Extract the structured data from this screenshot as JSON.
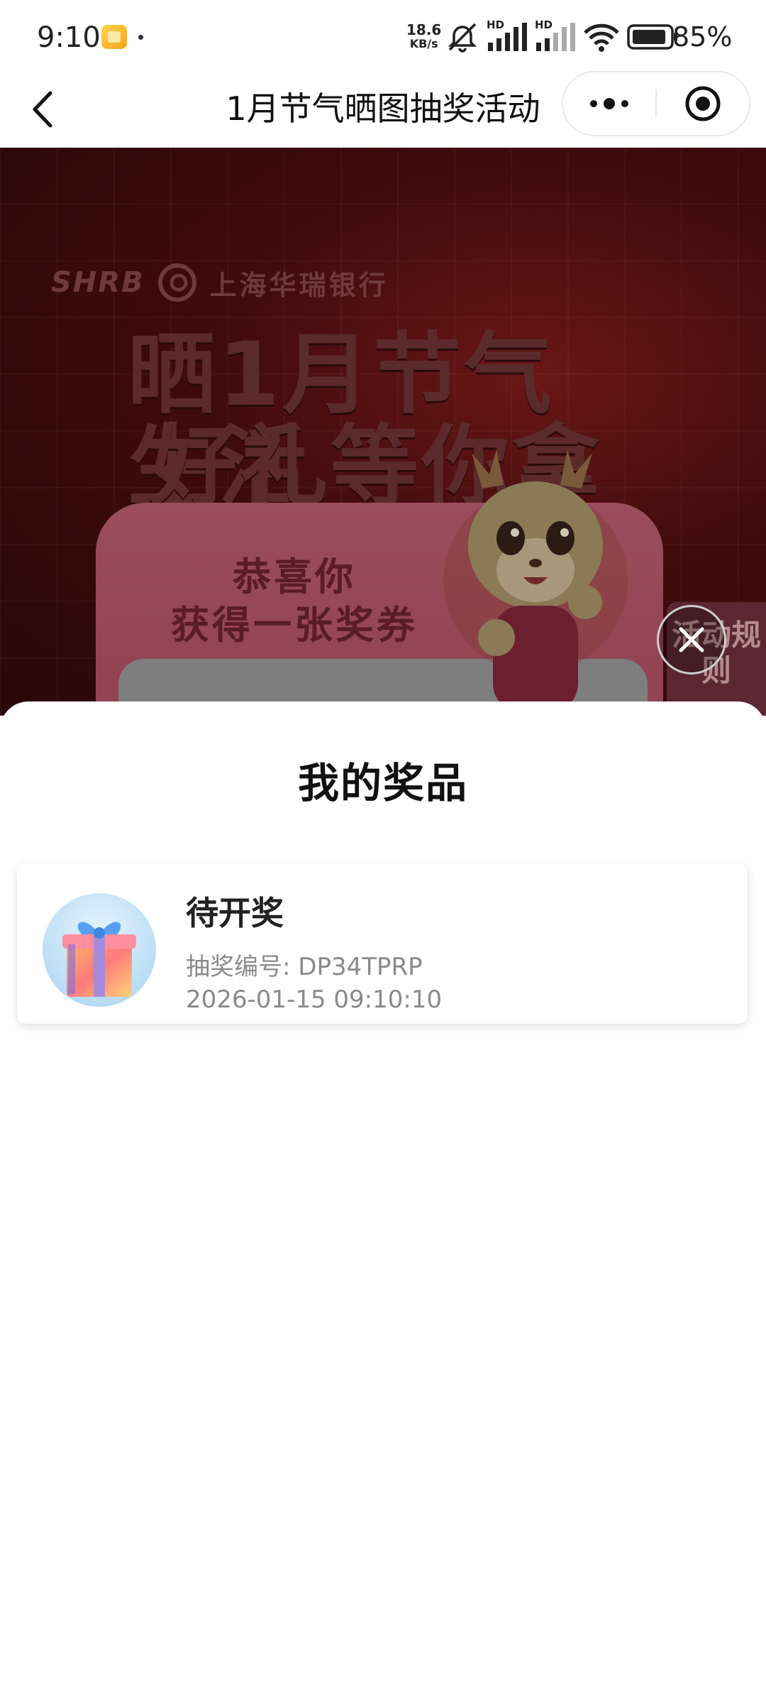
{
  "status_bar": {
    "time": "9:10",
    "rate_value": "18.6",
    "rate_unit": "KB/s",
    "signal_label_1": "HD",
    "signal_label_2": "HD",
    "battery": "85%"
  },
  "header": {
    "title": "1月节气晒图抽奖活动"
  },
  "banner": {
    "bank_code": "SHRB",
    "bank_name": "上海华瑞银行",
    "headline_line1": "晒1月节气生活",
    "headline_line2": "好礼等你拿",
    "card_line1": "恭喜你",
    "card_line2": "获得一张奖券",
    "rules_tab": "活动规则"
  },
  "sheet": {
    "title": "我的奖品",
    "prize": {
      "status": "待开奖",
      "code_label": "抽奖编号:",
      "code": "DP34TPRP",
      "time": "2026-01-15 09:10:10"
    }
  }
}
